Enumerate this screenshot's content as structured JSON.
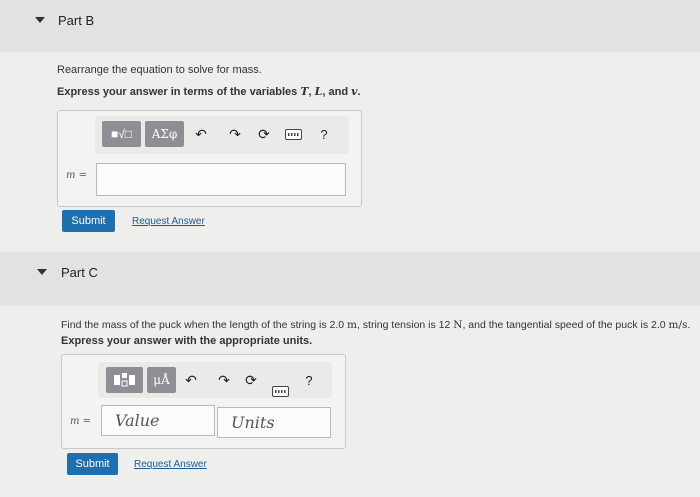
{
  "partB": {
    "title": "Part B",
    "instruction": "Rearrange the equation to solve for mass.",
    "express_prefix": "Express your answer in terms of the variables ",
    "var_t": "T",
    "sep1": ", ",
    "var_l": "L",
    "sep2": ", and ",
    "var_v": "v",
    "period": ".",
    "toolbar": {
      "templates": "■√□",
      "symbols": "ΑΣφ",
      "help": "?"
    },
    "answer_label": "m =",
    "answer_value": "",
    "submit_label": "Submit",
    "request_label": "Request Answer"
  },
  "partC": {
    "title": "Part C",
    "q1": "Find the mass of the puck when the length of the string is 2.0 ",
    "u1": "m",
    "q2": ", string tension is 12 ",
    "u2": "N",
    "q3": ", and the tangential speed of the puck is 2.0 ",
    "u3": "m/s",
    "q4": ".",
    "express": "Express your answer with the appropriate units.",
    "toolbar": {
      "units": "μÅ",
      "help": "?"
    },
    "answer_label": "m =",
    "value_placeholder": "Value",
    "units_placeholder": "Units",
    "submit_label": "Submit",
    "request_label": "Request Answer"
  },
  "colors": {
    "submit": "#1e6fb0",
    "link": "#1e5a95",
    "toolbar_button": "#8d8f94"
  },
  "icons": [
    "collapse-triangle-icon",
    "undo-icon",
    "redo-icon",
    "reset-icon",
    "keyboard-icon",
    "help-icon"
  ]
}
